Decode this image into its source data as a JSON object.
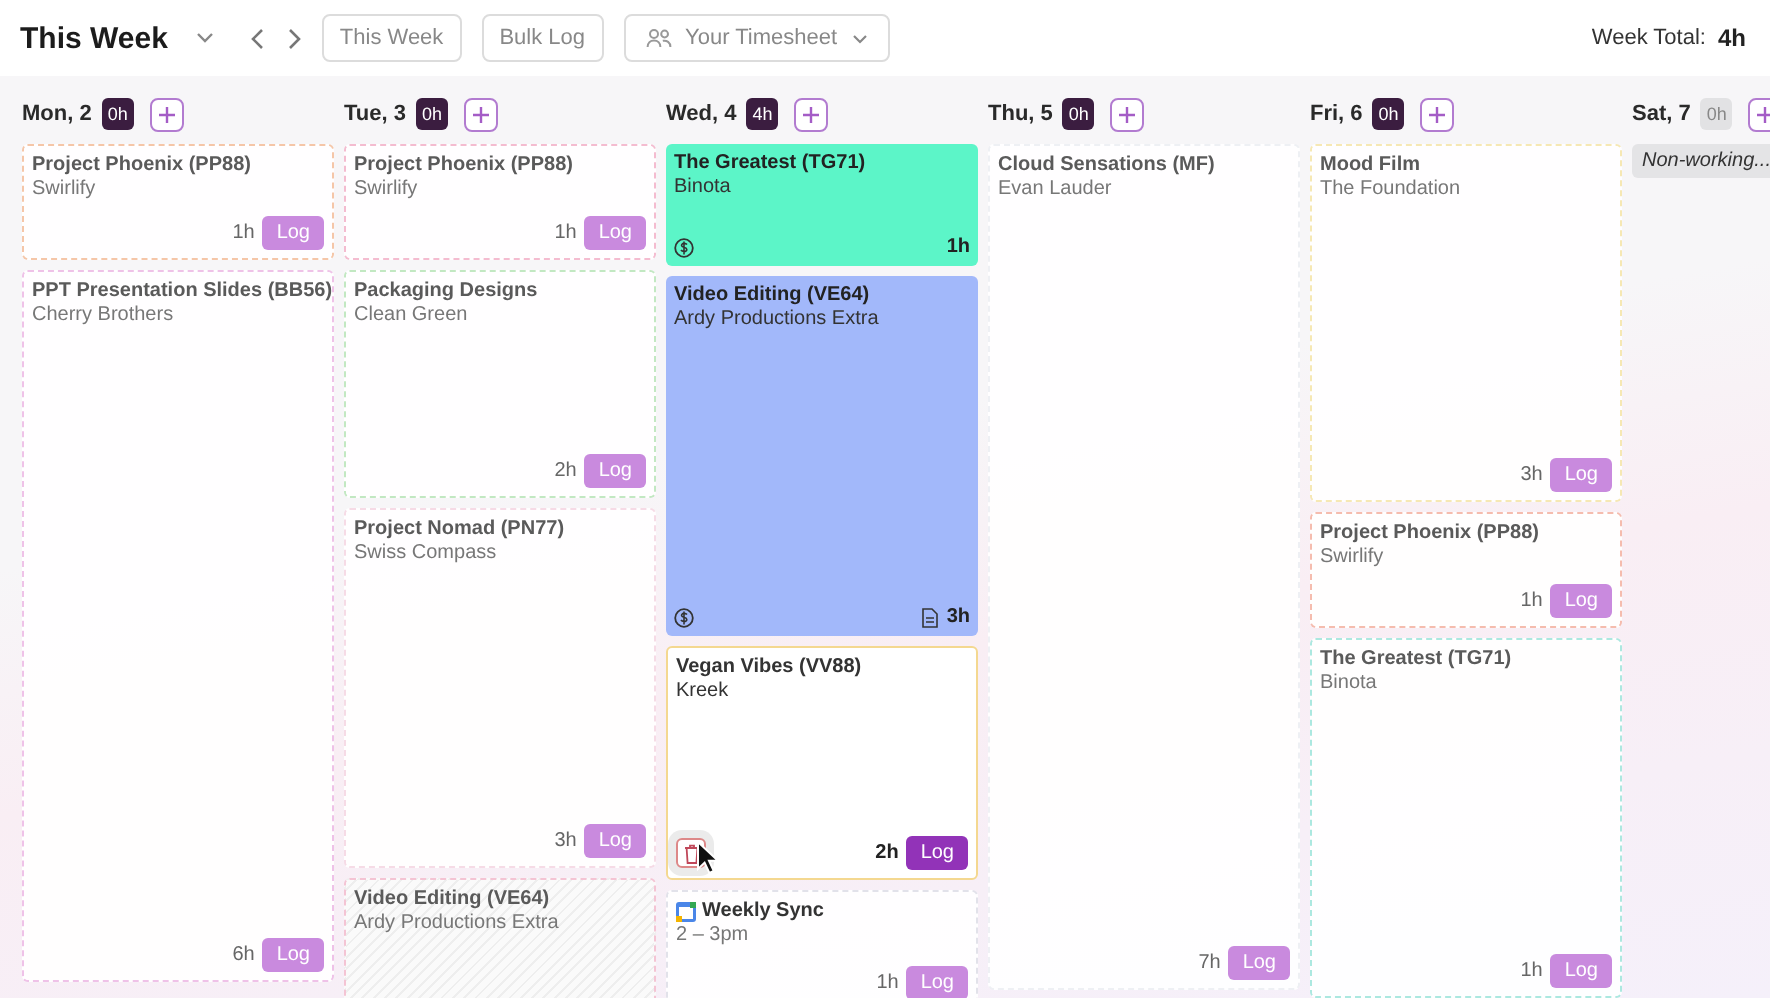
{
  "header": {
    "title": "This Week",
    "buttons": [
      "This Week",
      "Bulk Log"
    ],
    "timesheet": "Your Timesheet",
    "total_label": "Week Total:",
    "total": "4h"
  },
  "days": [
    {
      "label": "Mon, 2",
      "hours": "0h",
      "working": true,
      "entries": [
        {
          "kind": "task",
          "title": "Project Phoenix (PP88)",
          "client": "Swirlify",
          "hours": "1h",
          "action": "Log",
          "color": "#f5c6a8",
          "hovered": false
        },
        {
          "kind": "task",
          "title": "PPT Presentation Slides (BB56)",
          "client": "Cherry Brothers",
          "hours": "6h",
          "action": "Log",
          "color": "#efc2e8",
          "hovered": false
        }
      ]
    },
    {
      "label": "Tue, 3",
      "hours": "0h",
      "working": true,
      "entries": [
        {
          "kind": "task",
          "title": "Project Phoenix (PP88)",
          "client": "Swirlify",
          "hours": "1h",
          "action": "Log",
          "color": "#f4bcd0",
          "hovered": false
        },
        {
          "kind": "task",
          "title": "Packaging Designs",
          "client": "Clean Green",
          "hours": "2h",
          "action": "Log",
          "color": "#c2e8c2",
          "hovered": false
        },
        {
          "kind": "task",
          "title": "Project Nomad (PN77)",
          "client": "Swiss Compass",
          "hours": "3h",
          "action": "Log",
          "color": "#f6dbe6",
          "hovered": false
        },
        {
          "kind": "hatched",
          "title": "Video Editing (VE64)",
          "client": "Ardy Productions Extra",
          "color": "#f4c4d4"
        }
      ]
    },
    {
      "label": "Wed, 4",
      "hours": "4h",
      "working": true,
      "entries": [
        {
          "kind": "logged",
          "title": "The Greatest (TG71)",
          "client": "Binota",
          "hours": "1h",
          "color": "#5cf5c8",
          "note": false
        },
        {
          "kind": "logged",
          "title": "Video Editing (VE64)",
          "client": "Ardy Productions Extra",
          "hours": "3h",
          "color": "#a2b8fa",
          "note": true
        },
        {
          "kind": "task",
          "title": "Vegan Vibes (VV88)",
          "client": "Kreek",
          "hours": "2h",
          "action": "Log",
          "color": "#f4d890",
          "hovered": true
        },
        {
          "kind": "event",
          "title": "Weekly Sync",
          "time": "2 – 3pm",
          "hours": "1h",
          "action": "Log",
          "color": "#e2e2ea"
        }
      ]
    },
    {
      "label": "Thu, 5",
      "hours": "0h",
      "working": true,
      "entries": [
        {
          "kind": "task",
          "title": "Cloud Sensations (MF)",
          "client": "Evan Lauder",
          "hours": "7h",
          "action": "Log",
          "color": "#eef0f4",
          "hovered": false
        }
      ]
    },
    {
      "label": "Fri, 6",
      "hours": "0h",
      "working": true,
      "entries": [
        {
          "kind": "task",
          "title": "Mood Film",
          "client": "The Foundation",
          "hours": "3h",
          "action": "Log",
          "color": "#f6e8b4",
          "hovered": false
        },
        {
          "kind": "task",
          "title": "Project Phoenix (PP88)",
          "client": "Swirlify",
          "hours": "1h",
          "action": "Log",
          "color": "#f5bcae",
          "hovered": false
        },
        {
          "kind": "task",
          "title": "The Greatest (TG71)",
          "client": "Binota",
          "hours": "1h",
          "action": "Log",
          "color": "#ace8e0",
          "hovered": false
        }
      ]
    },
    {
      "label": "Sat, 7",
      "hours": "0h",
      "working": false,
      "entries": [
        {
          "kind": "note",
          "title": "Non-working..."
        }
      ]
    }
  ]
}
